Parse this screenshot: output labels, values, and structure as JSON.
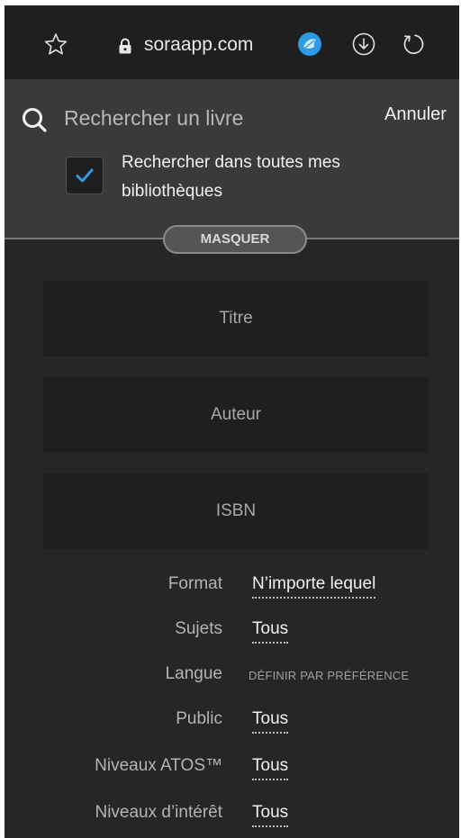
{
  "browser": {
    "url": "soraapp.com"
  },
  "search": {
    "placeholder": "Rechercher un livre",
    "cancel_label": "Annuler",
    "all_libraries_label": "Rechercher dans toutes mes bibliothèques",
    "all_libraries_checked": true,
    "hide_label": "MASQUER"
  },
  "fields": {
    "title": "Titre",
    "author": "Auteur",
    "isbn": "ISBN"
  },
  "filters": {
    "format": {
      "label": "Format",
      "value": "N’importe lequel"
    },
    "subjects": {
      "label": "Sujets",
      "value": "Tous"
    },
    "language": {
      "label": "Langue",
      "value": "DÉFINIR PAR PRÉFÉRENCE"
    },
    "audience": {
      "label": "Public",
      "value": "Tous"
    },
    "atos": {
      "label": "Niveaux ATOS™",
      "value": "Tous"
    },
    "interest": {
      "label": "Niveaux d’intérêt",
      "value": "Tous"
    }
  },
  "colors": {
    "accent": "#2e9ae6",
    "background": "#262626",
    "panel": "#3a3a3a"
  }
}
